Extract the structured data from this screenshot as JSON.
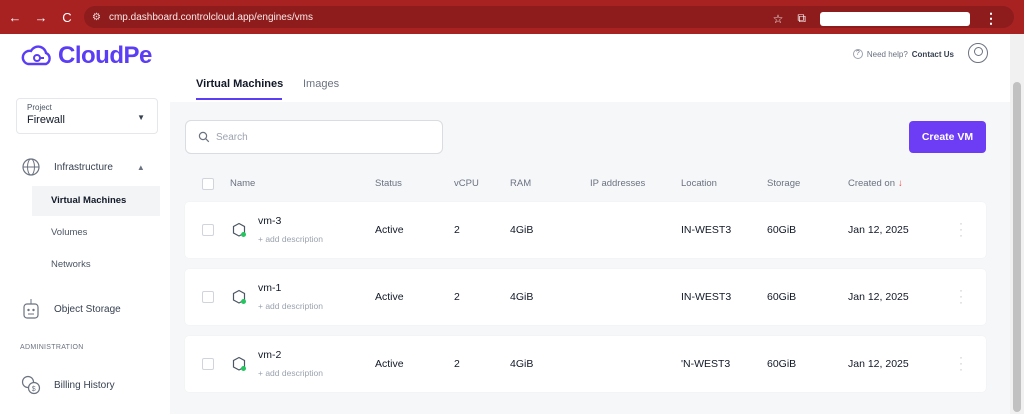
{
  "browser": {
    "back": "←",
    "forward": "→",
    "reload": "C",
    "url": "cmp.dashboard.controlcloud.app/engines/vms",
    "more": "⋮"
  },
  "header": {
    "brand": "CloudPe",
    "help_text": "Need help?",
    "contact": "Contact Us"
  },
  "sidebar": {
    "project_label": "Project",
    "project_value": "Firewall",
    "infrastructure": "Infrastructure",
    "items": [
      "Virtual Machines",
      "Volumes",
      "Networks"
    ],
    "object_storage": "Object Storage",
    "admin_label": "ADMINISTRATION",
    "billing": "Billing History"
  },
  "tabs": [
    "Virtual Machines",
    "Images"
  ],
  "search": {
    "placeholder": "Search"
  },
  "create_button": "Create VM",
  "columns": [
    "Name",
    "Status",
    "vCPU",
    "RAM",
    "IP addresses",
    "Location",
    "Storage",
    "Created on"
  ],
  "add_description": "+ add description",
  "rows": [
    {
      "name": "vm-3",
      "status": "Active",
      "vcpu": "2",
      "ram": "4GiB",
      "location": "IN-WEST3",
      "storage": "60GiB",
      "created": "Jan 12, 2025"
    },
    {
      "name": "vm-1",
      "status": "Active",
      "vcpu": "2",
      "ram": "4GiB",
      "location": "IN-WEST3",
      "storage": "60GiB",
      "created": "Jan 12, 2025"
    },
    {
      "name": "vm-2",
      "status": "Active",
      "vcpu": "2",
      "ram": "4GiB",
      "location": "'N-WEST3",
      "storage": "60GiB",
      "created": "Jan 12, 2025"
    }
  ],
  "colors": {
    "brand": "#5b3df5",
    "chrome": "#a82222",
    "status_dot": "#22c55e"
  },
  "icons": [
    "star-icon",
    "extension-icon",
    "site-info-icon",
    "cloud-logo-icon",
    "help-icon",
    "user-avatar-icon",
    "infrastructure-icon",
    "object-storage-icon",
    "billing-icon",
    "search-icon",
    "vm-icon",
    "kebab-icon",
    "sort-down-icon"
  ]
}
